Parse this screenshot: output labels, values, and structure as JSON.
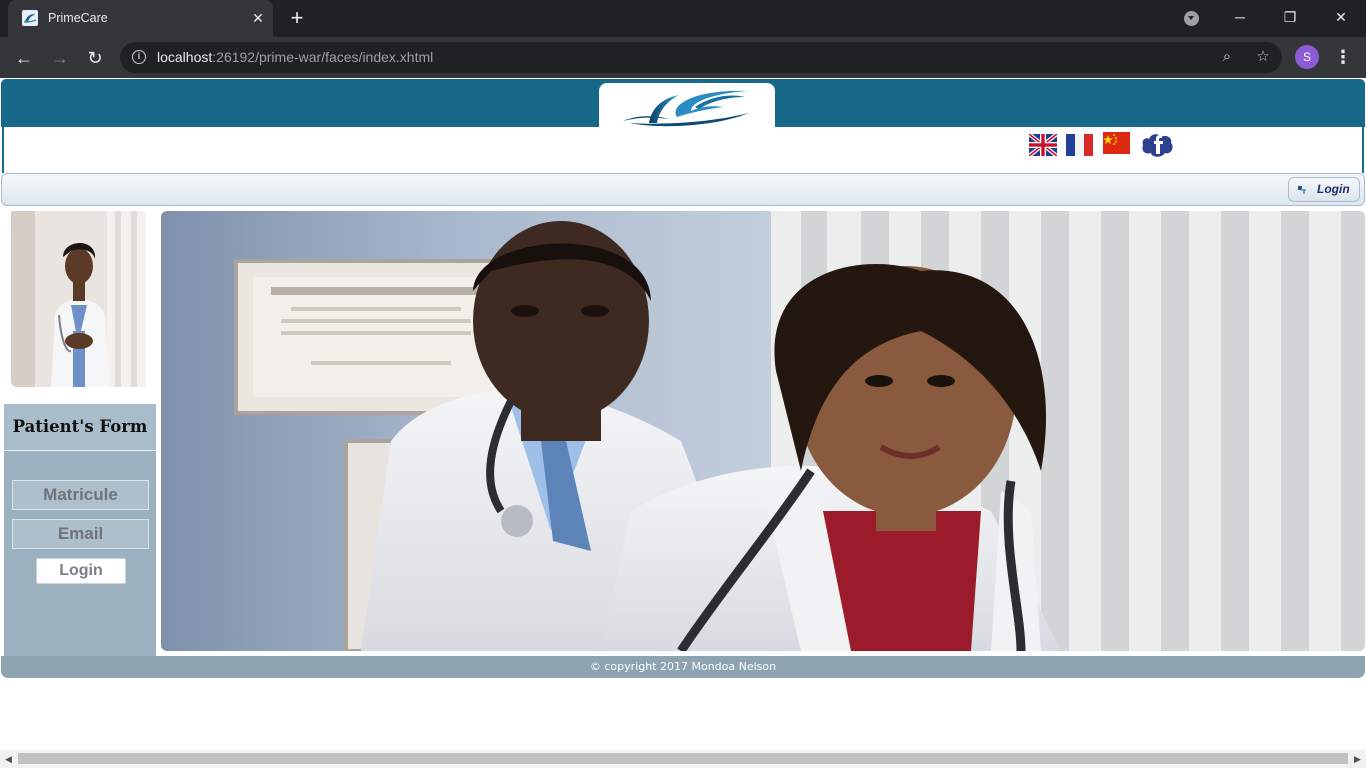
{
  "browser": {
    "tab_title": "PrimeCare",
    "tab_close": "✕",
    "new_tab": "+",
    "url_host": "localhost",
    "url_path": ":26192/prime-war/faces/index.xhtml",
    "profile_initial": "S",
    "window_minimize": "─",
    "window_restore": "❐",
    "window_close": "✕",
    "back": "←",
    "forward": "→",
    "reload": "↻",
    "zoom_icon": "⌕",
    "star_icon": "☆",
    "menu": "⋮"
  },
  "header": {
    "brand_color": "#17698a",
    "flags": [
      "uk-flag",
      "france-flag",
      "china-flag",
      "facebook-icon"
    ]
  },
  "menubar": {
    "login_label": "Login"
  },
  "sidebar": {
    "form_title": "Patient's Form",
    "matricule_placeholder": "Matricule",
    "email_placeholder": "Email",
    "login_label": "Login"
  },
  "footer": {
    "copyright": "© copyright 2017 Mondoa Nelson"
  }
}
